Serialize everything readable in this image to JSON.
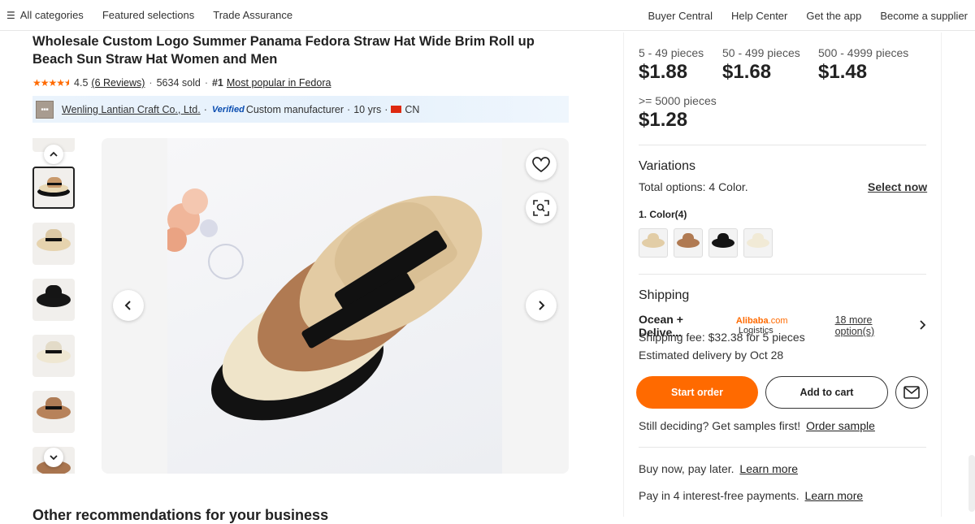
{
  "topnav": {
    "left": [
      {
        "label": "All categories",
        "icon": "menu-icon"
      },
      {
        "label": "Featured selections"
      },
      {
        "label": "Trade Assurance"
      }
    ],
    "right": [
      "Buyer Central",
      "Help Center",
      "Get the app",
      "Become a supplier"
    ]
  },
  "product": {
    "title": "Wholesale Custom Logo Summer Panama Fedora Straw Hat Wide Brim Roll up Beach Sun Straw Hat Women and Men",
    "rating": "4.5",
    "rating_stars": 4.5,
    "reviews": "(6 Reviews)",
    "sold": "5634 sold",
    "rank_badge": "#1",
    "rank_text": "Most popular in Fedora"
  },
  "supplier": {
    "name": "Wenling Lantian Craft Co., Ltd.",
    "verified": "Verified",
    "type": "Custom manufacturer",
    "years": "10 yrs",
    "country": "CN"
  },
  "gallery": {
    "thumbnails": [
      {
        "colors": [
          "#3a3a3a",
          "#e8d8b8"
        ]
      },
      {
        "colors": [
          "#d9c39b",
          "#111111"
        ],
        "active": true
      },
      {
        "colors": [
          "#e6d3ae"
        ]
      },
      {
        "colors": [
          "#161616"
        ]
      },
      {
        "colors": [
          "#efe7d2"
        ]
      },
      {
        "colors": [
          "#b7825a"
        ]
      },
      {
        "colors": [
          "#a9754f"
        ]
      }
    ],
    "icons": [
      "chevron-up-icon",
      "chevron-down-icon",
      "heart-icon",
      "image-search-icon",
      "chevron-left-icon",
      "chevron-right-icon"
    ]
  },
  "pricing": {
    "tiers": [
      {
        "qty": "5 - 49 pieces",
        "price": "$1.88"
      },
      {
        "qty": "50 - 499 pieces",
        "price": "$1.68"
      },
      {
        "qty": "500 - 4999 pieces",
        "price": "$1.48"
      },
      {
        "qty": ">= 5000 pieces",
        "price": "$1.28"
      }
    ]
  },
  "variations": {
    "title": "Variations",
    "total_label": "Total options:",
    "total_value": "4 Color.",
    "select_now": "Select now",
    "color_label": "1. Color(4)",
    "swatches": [
      "#e2cda6",
      "#b07a52",
      "#141414",
      "#f1ead6"
    ]
  },
  "shipping": {
    "title": "Shipping",
    "method": "Ocean + Delive...",
    "logistics_brand": "Alibaba",
    "logistics_domain": ".com",
    "logistics_label": "Logistics",
    "more_options": "18 more option(s)",
    "fee": "Shipping fee: $32.38 for 5 pieces",
    "delivery": "Estimated delivery by Oct 28"
  },
  "actions": {
    "start_order": "Start order",
    "add_to_cart": "Add to cart",
    "samples_text": "Still deciding? Get samples first!",
    "order_sample": "Order sample"
  },
  "payment": {
    "bnpl_text": "Buy now, pay later.",
    "bnpl_link": "Learn more",
    "installments_text": "Pay in 4 interest-free payments.",
    "installments_link": "Learn more"
  },
  "recommendations": {
    "heading": "Other recommendations for your business"
  },
  "colors": {
    "accent": "#ff6a00",
    "verified": "#0a4db0"
  }
}
